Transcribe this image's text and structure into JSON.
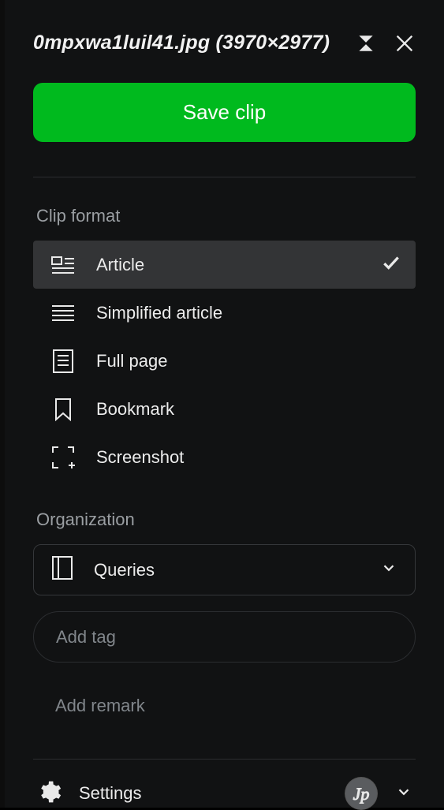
{
  "header": {
    "title": "0mpxwa1luil41.jpg (3970×2977)"
  },
  "actions": {
    "save_label": "Save clip"
  },
  "clip_format": {
    "section_label": "Clip format",
    "items": [
      {
        "label": "Article",
        "icon": "article-icon",
        "selected": true
      },
      {
        "label": "Simplified article",
        "icon": "lines-icon",
        "selected": false
      },
      {
        "label": "Full page",
        "icon": "page-icon",
        "selected": false
      },
      {
        "label": "Bookmark",
        "icon": "bookmark-icon",
        "selected": false
      },
      {
        "label": "Screenshot",
        "icon": "screenshot-icon",
        "selected": false
      }
    ]
  },
  "organization": {
    "section_label": "Organization",
    "notebook": {
      "label": "Queries",
      "icon": "notebook-icon"
    },
    "tag_placeholder": "Add tag",
    "remark_placeholder": "Add remark"
  },
  "footer": {
    "settings_label": "Settings"
  }
}
